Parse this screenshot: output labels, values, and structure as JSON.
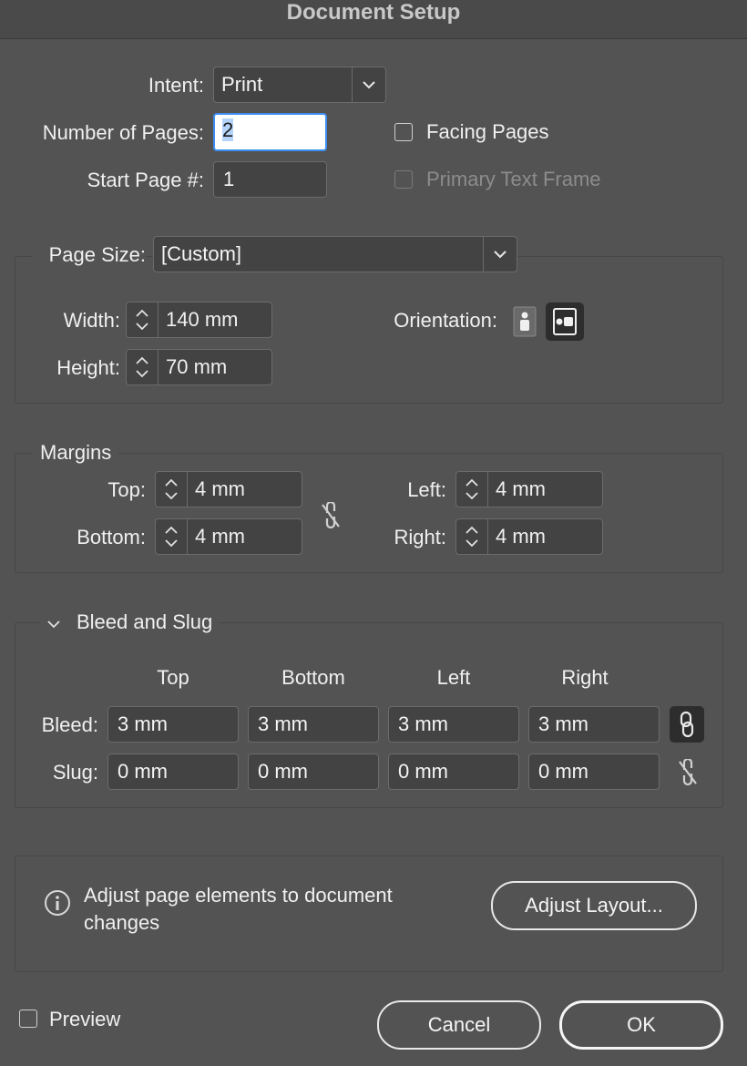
{
  "window": {
    "title": "Document Setup"
  },
  "intent": {
    "label": "Intent:",
    "value": "Print"
  },
  "pages": {
    "count_label": "Number of Pages:",
    "count_value": "2",
    "start_label": "Start Page #:",
    "start_value": "1",
    "facing_label": "Facing Pages",
    "facing_checked": false,
    "primary_label": "Primary Text Frame",
    "primary_checked": false,
    "primary_enabled": false
  },
  "page_size": {
    "label": "Page Size:",
    "value": "[Custom]",
    "width_label": "Width:",
    "width_value": "140 mm",
    "height_label": "Height:",
    "height_value": "70 mm",
    "orientation_label": "Orientation:",
    "orientation_selected": "landscape"
  },
  "margins": {
    "title": "Margins",
    "top_label": "Top:",
    "top_value": "4 mm",
    "bottom_label": "Bottom:",
    "bottom_value": "4 mm",
    "left_label": "Left:",
    "left_value": "4 mm",
    "right_label": "Right:",
    "right_value": "4 mm",
    "linked": false
  },
  "bleed_slug": {
    "title": "Bleed and Slug",
    "col_top": "Top",
    "col_bottom": "Bottom",
    "col_left": "Left",
    "col_right": "Right",
    "bleed_label": "Bleed:",
    "bleed_values": [
      "3 mm",
      "3 mm",
      "3 mm",
      "3 mm"
    ],
    "bleed_linked": true,
    "slug_label": "Slug:",
    "slug_values": [
      "0 mm",
      "0 mm",
      "0 mm",
      "0 mm"
    ],
    "slug_linked": false
  },
  "adjust": {
    "text_line1": "Adjust page elements to document",
    "text_line2": "changes",
    "button": "Adjust Layout..."
  },
  "footer": {
    "preview_label": "Preview",
    "preview_checked": false,
    "cancel": "Cancel",
    "ok": "OK"
  },
  "colors": {
    "background": "#535353",
    "field": "#434343",
    "focus": "#3b8ef0"
  }
}
